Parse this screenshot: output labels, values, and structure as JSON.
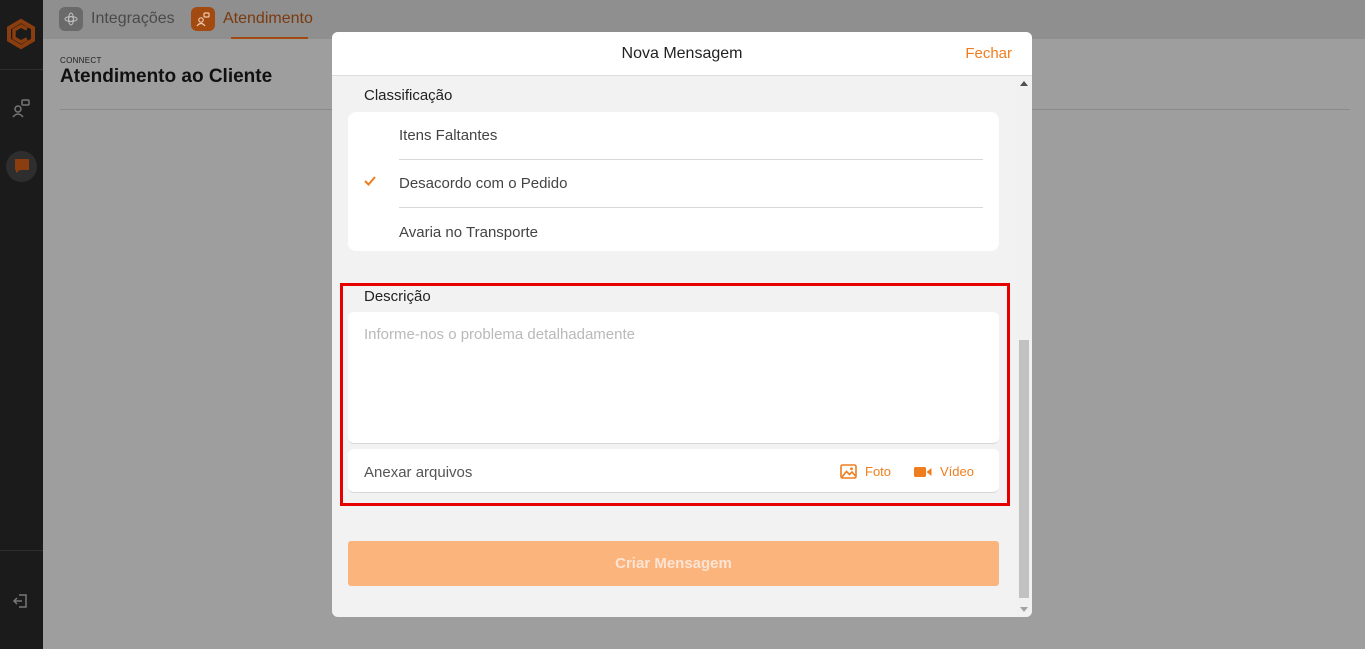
{
  "app": {
    "tabs": [
      {
        "label": "Integrações",
        "icon": "integration-icon"
      },
      {
        "label": "Atendimento",
        "icon": "support-icon"
      }
    ]
  },
  "page": {
    "kicker": "CONNECT",
    "title": "Atendimento ao Cliente"
  },
  "modal": {
    "title": "Nova Mensagem",
    "close_label": "Fechar",
    "classificacao_label": "Classificação",
    "classificacao_options": [
      {
        "label": "Itens Faltantes",
        "selected": false
      },
      {
        "label": "Desacordo com o Pedido",
        "selected": true
      },
      {
        "label": "Avaria no Transporte",
        "selected": false
      }
    ],
    "descricao_label": "Descrição",
    "descricao_placeholder": "Informe-nos o problema detalhadamente",
    "descricao_value": "",
    "attach_label": "Anexar arquivos",
    "attach_photo_label": "Foto",
    "attach_video_label": "Vídeo",
    "submit_label": "Criar Mensagem"
  },
  "colors": {
    "accent": "#ef7d1e",
    "button_disabled": "#fcb47d",
    "highlight": "#e60000"
  }
}
